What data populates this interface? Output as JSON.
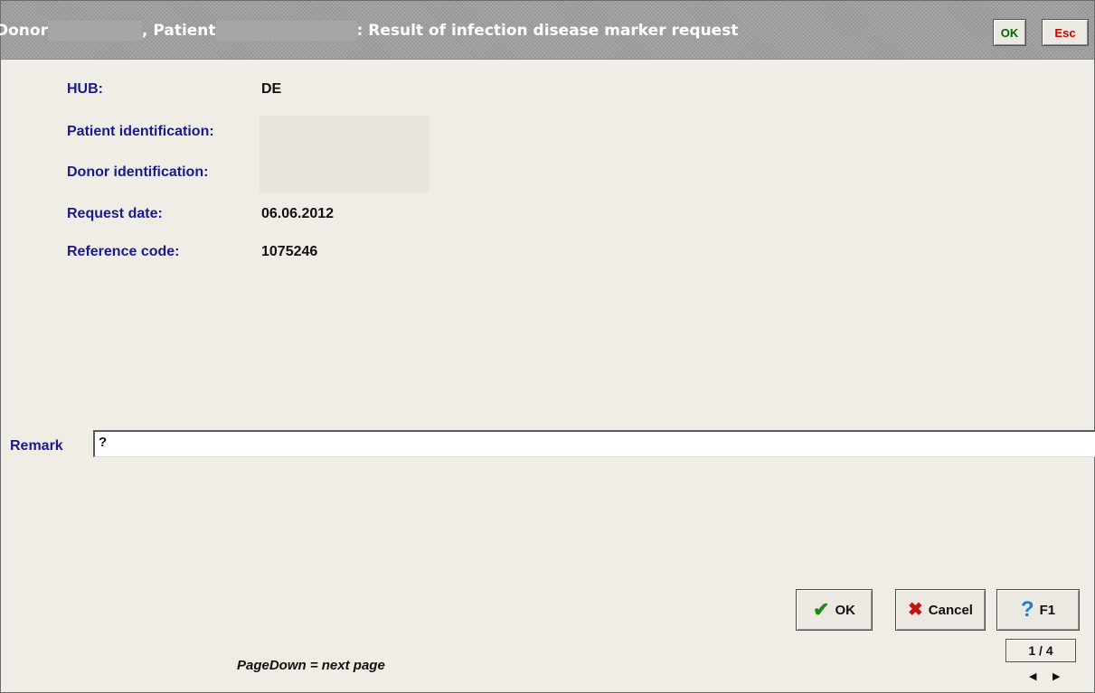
{
  "titlebar": {
    "donor_label": "Donor",
    "patient_label": ", Patient",
    "subject": ": Result of infection disease marker request",
    "ok_label": "OK",
    "esc_label": "Esc"
  },
  "fields": {
    "hub_label": "HUB:",
    "hub_value": "DE",
    "patient_id_label": "Patient identification:",
    "donor_id_label": "Donor identification:",
    "request_date_label": "Request date:",
    "request_date_value": "06.06.2012",
    "reference_code_label": "Reference code:",
    "reference_code_value": "1075246"
  },
  "remark": {
    "label": "Remark",
    "value": "?"
  },
  "buttons": {
    "ok_label": "OK",
    "cancel_label": "Cancel",
    "f1_label": "F1"
  },
  "pager": {
    "page_indicator": "1 / 4",
    "hint": "PageDown = next page"
  },
  "icons": {
    "ok_icon": "check-icon",
    "cancel_icon": "x-icon",
    "help_icon": "question-icon",
    "prev_icon": "arrow-left-icon",
    "next_icon": "arrow-right-icon"
  },
  "colors": {
    "label_blue": "#1a1a8c",
    "ok_green": "#1e8a1e",
    "cancel_red": "#c01515",
    "help_blue": "#1c7fd6",
    "titlebar_gray": "#9e9e9e",
    "background": "#f0ede6"
  }
}
